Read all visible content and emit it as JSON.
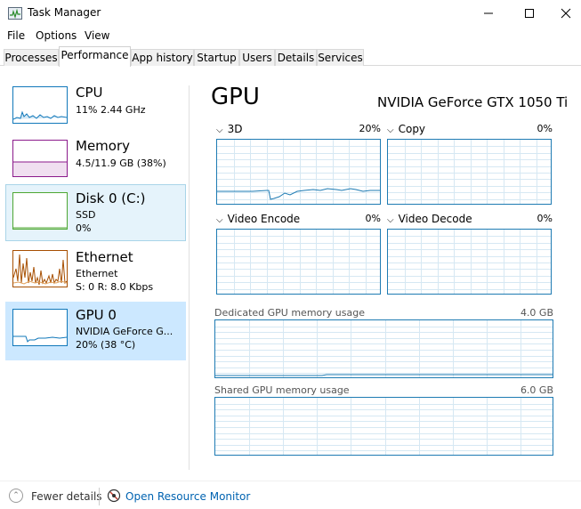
{
  "window": {
    "title": "Task Manager"
  },
  "menu": [
    "File",
    "Options",
    "View"
  ],
  "tabs": [
    "Processes",
    "Performance",
    "App history",
    "Startup",
    "Users",
    "Details",
    "Services"
  ],
  "sidebar": {
    "items": [
      {
        "title": "CPU",
        "line1": "11% 2.44 GHz",
        "line2": "",
        "color": "#1178ba"
      },
      {
        "title": "Memory",
        "line1": "4.5/11.9 GB (38%)",
        "line2": "",
        "color": "#8b1a8b"
      },
      {
        "title": "Disk 0 (C:)",
        "line1": "SSD",
        "line2": "0%",
        "color": "#4da733"
      },
      {
        "title": "Ethernet",
        "line1": "Ethernet",
        "line2": "S: 0 R: 8.0 Kbps",
        "color": "#a74f01"
      },
      {
        "title": "GPU 0",
        "line1": "NVIDIA GeForce G...",
        "line2": "20% (38 °C)",
        "color": "#1178ba"
      }
    ]
  },
  "main": {
    "title": "GPU",
    "device": "NVIDIA GeForce GTX 1050 Ti",
    "engines": [
      {
        "label": "3D",
        "pct": "20%"
      },
      {
        "label": "Copy",
        "pct": "0%"
      },
      {
        "label": "Video Encode",
        "pct": "0%"
      },
      {
        "label": "Video Decode",
        "pct": "0%"
      }
    ],
    "dedicated": {
      "label": "Dedicated GPU memory usage",
      "cap": "4.0 GB"
    },
    "shared": {
      "label": "Shared GPU memory usage",
      "cap": "6.0 GB"
    }
  },
  "footer": {
    "fewer": "Fewer details",
    "monitor": "Open Resource Monitor"
  },
  "colors": {
    "accent": "#1e7bb3",
    "grid": "#d6e8f3",
    "link": "#0063b1"
  }
}
